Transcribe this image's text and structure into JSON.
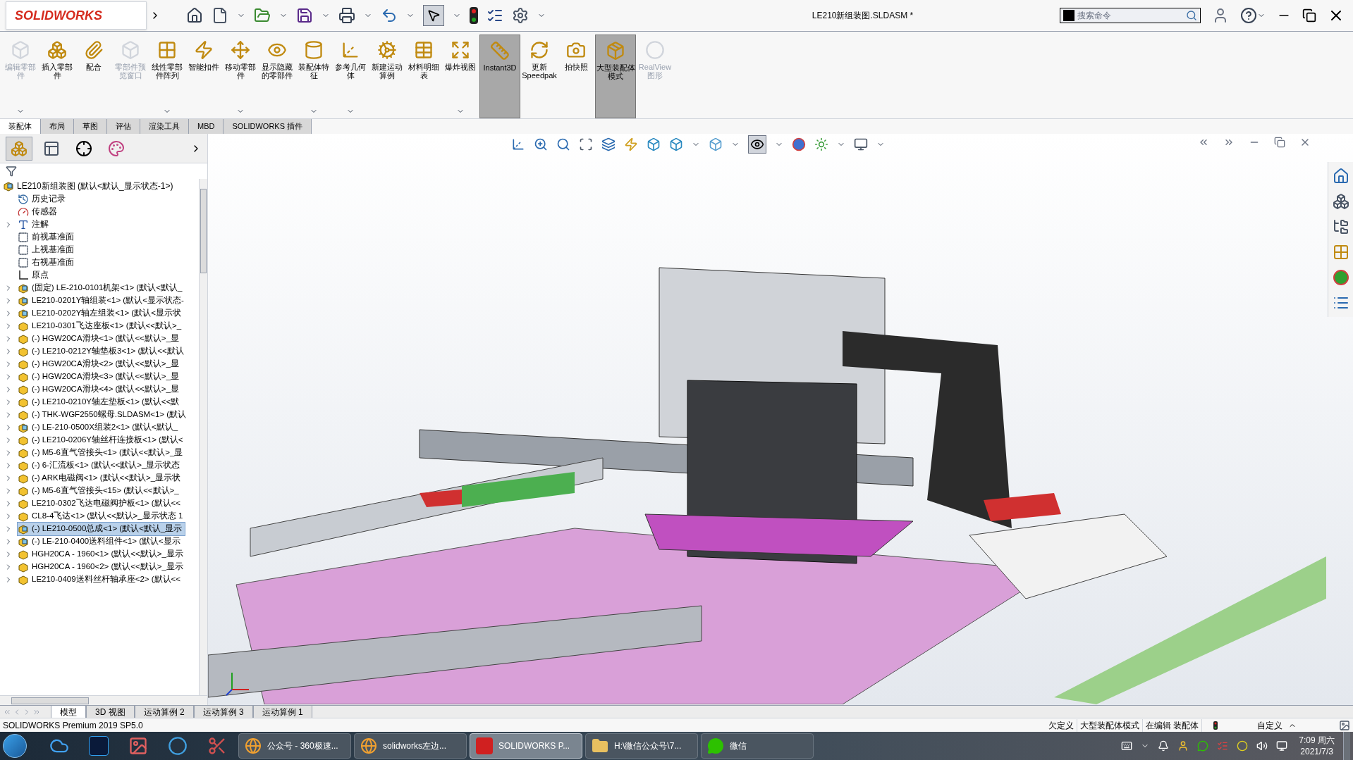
{
  "app": {
    "logo": "SOLIDWORKS",
    "title": "LE210新组装图.SLDASM *",
    "search": {
      "placeholder": "搜索命令"
    }
  },
  "ribbon": [
    {
      "label": "编辑零部件",
      "disabled": true,
      "selected": false,
      "dropdown": true
    },
    {
      "label": "插入零部件",
      "disabled": false,
      "selected": false,
      "dropdown": false
    },
    {
      "label": "配合",
      "disabled": false,
      "selected": false,
      "dropdown": false
    },
    {
      "label": "零部件预览窗口",
      "disabled": true,
      "selected": false,
      "dropdown": false
    },
    {
      "label": "线性零部件阵列",
      "disabled": false,
      "selected": false,
      "dropdown": true
    },
    {
      "label": "智能扣件",
      "disabled": false,
      "selected": false,
      "dropdown": false
    },
    {
      "label": "移动零部件",
      "disabled": false,
      "selected": false,
      "dropdown": true
    },
    {
      "label": "显示隐藏的零部件",
      "disabled": false,
      "selected": false,
      "dropdown": false
    },
    {
      "label": "装配体特征",
      "disabled": false,
      "selected": false,
      "dropdown": true
    },
    {
      "label": "参考几何体",
      "disabled": false,
      "selected": false,
      "dropdown": true
    },
    {
      "label": "新建运动算例",
      "disabled": false,
      "selected": false,
      "dropdown": false
    },
    {
      "label": "材料明细表",
      "disabled": false,
      "selected": false,
      "dropdown": false
    },
    {
      "label": "爆炸视图",
      "disabled": false,
      "selected": false,
      "dropdown": true
    },
    {
      "label": "Instant3D",
      "disabled": false,
      "selected": true,
      "dropdown": false
    },
    {
      "label": "更新 Speedpak",
      "disabled": false,
      "selected": false,
      "dropdown": false
    },
    {
      "label": "拍快照",
      "disabled": false,
      "selected": false,
      "dropdown": false
    },
    {
      "label": "大型装配体模式",
      "disabled": false,
      "selected": true,
      "dropdown": false
    },
    {
      "label": "RealView 图形",
      "disabled": true,
      "selected": false,
      "dropdown": false
    }
  ],
  "command_tabs": [
    {
      "label": "装配体",
      "selected": true
    },
    {
      "label": "布局",
      "selected": false
    },
    {
      "label": "草图",
      "selected": false
    },
    {
      "label": "评估",
      "selected": false
    },
    {
      "label": "渲染工具",
      "selected": false
    },
    {
      "label": "MBD",
      "selected": false
    },
    {
      "label": "SOLIDWORKS 插件",
      "selected": false
    }
  ],
  "tree": {
    "root": "LE210新组装图  (默认<默认_显示状态-1>)",
    "items": [
      {
        "kind": "history",
        "label": "历史记录",
        "expandable": false,
        "selected": false
      },
      {
        "kind": "sensor",
        "label": "传感器",
        "expandable": false,
        "selected": false
      },
      {
        "kind": "annotation",
        "label": "注解",
        "expandable": true,
        "selected": false
      },
      {
        "kind": "plane",
        "label": "前视基准面",
        "expandable": false,
        "selected": false
      },
      {
        "kind": "plane",
        "label": "上视基准面",
        "expandable": false,
        "selected": false
      },
      {
        "kind": "plane",
        "label": "右视基准面",
        "expandable": false,
        "selected": false
      },
      {
        "kind": "origin",
        "label": "原点",
        "expandable": false,
        "selected": false
      },
      {
        "kind": "assembly",
        "label": "(固定) LE-210-0101机架<1> (默认<默认_",
        "expandable": true,
        "selected": false
      },
      {
        "kind": "assembly",
        "label": "LE210-0201Y轴组装<1> (默认<显示状态-",
        "expandable": true,
        "selected": false
      },
      {
        "kind": "assembly",
        "label": "LE210-0202Y轴左组装<1> (默认<显示状",
        "expandable": true,
        "selected": false
      },
      {
        "kind": "part",
        "label": "LE210-0301飞达座板<1> (默认<<默认>_",
        "expandable": true,
        "selected": false
      },
      {
        "kind": "part",
        "label": "(-) HGW20CA滑块<1> (默认<<默认>_显",
        "expandable": true,
        "selected": false
      },
      {
        "kind": "part",
        "label": "(-) LE210-0212Y轴垫板3<1> (默认<<默认",
        "expandable": true,
        "selected": false
      },
      {
        "kind": "part",
        "label": "(-) HGW20CA滑块<2> (默认<<默认>_显",
        "expandable": true,
        "selected": false
      },
      {
        "kind": "part",
        "label": "(-) HGW20CA滑块<3> (默认<<默认>_显",
        "expandable": true,
        "selected": false
      },
      {
        "kind": "part",
        "label": "(-) HGW20CA滑块<4> (默认<<默认>_显",
        "expandable": true,
        "selected": false
      },
      {
        "kind": "part",
        "label": "(-) LE210-0210Y轴左垫板<1> (默认<<默",
        "expandable": true,
        "selected": false
      },
      {
        "kind": "part",
        "label": "(-) THK-WGF2550螺母.SLDASM<1> (默认",
        "expandable": true,
        "selected": false
      },
      {
        "kind": "assembly",
        "label": "(-) LE-210-0500X组装2<1> (默认<默认_",
        "expandable": true,
        "selected": false
      },
      {
        "kind": "part",
        "label": "(-) LE210-0206Y轴丝杆连接板<1> (默认<",
        "expandable": true,
        "selected": false
      },
      {
        "kind": "part",
        "label": "(-) M5-6直气管接头<1> (默认<<默认>_显",
        "expandable": true,
        "selected": false
      },
      {
        "kind": "part",
        "label": "(-) 6-汇流板<1> (默认<<默认>_显示状态",
        "expandable": true,
        "selected": false
      },
      {
        "kind": "part",
        "label": "(-) ARK电磁阀<1> (默认<<默认>_显示状",
        "expandable": true,
        "selected": false
      },
      {
        "kind": "part",
        "label": "(-) M5-6直气管接头<15> (默认<<默认>_",
        "expandable": true,
        "selected": false
      },
      {
        "kind": "part",
        "label": "LE210-0302飞达电磁阀护板<1> (默认<<",
        "expandable": true,
        "selected": false
      },
      {
        "kind": "part",
        "label": "CL8-4飞达<1> (默认<<默认>_显示状态 1",
        "expandable": true,
        "selected": false
      },
      {
        "kind": "assembly",
        "label": "(-) LE210-0500总成<1> (默认<默认_显示",
        "expandable": true,
        "selected": true
      },
      {
        "kind": "assembly",
        "label": "(-) LE-210-0400送料组件<1> (默认<显示",
        "expandable": true,
        "selected": false
      },
      {
        "kind": "part",
        "label": "HGH20CA - 1960<1> (默认<<默认>_显示",
        "expandable": true,
        "selected": false
      },
      {
        "kind": "part",
        "label": "HGH20CA - 1960<2> (默认<<默认>_显示",
        "expandable": true,
        "selected": false
      },
      {
        "kind": "part",
        "label": "LE210-0409送料丝杆轴承座<2> (默认<<",
        "expandable": true,
        "selected": false
      }
    ]
  },
  "bottom_tabs": [
    {
      "label": "模型",
      "selected": true
    },
    {
      "label": "3D 视图",
      "selected": false
    },
    {
      "label": "运动算例 2",
      "selected": false
    },
    {
      "label": "运动算例 3",
      "selected": false
    },
    {
      "label": "运动算例 1",
      "selected": false
    }
  ],
  "status": {
    "product": "SOLIDWORKS Premium 2019 SP5.0",
    "items": [
      "欠定义",
      "大型装配体模式",
      "在编辑 装配体"
    ],
    "units": "自定义"
  },
  "taskbar": {
    "windows": [
      {
        "kind": "browser",
        "label": "公众号 - 360极速...",
        "selected": false
      },
      {
        "kind": "browser",
        "label": "solidworks左边...",
        "selected": false
      },
      {
        "kind": "solidworks",
        "label": "SOLIDWORKS P...",
        "selected": true
      },
      {
        "kind": "folder",
        "label": "H:\\微信公众号\\7...",
        "selected": false
      },
      {
        "kind": "wechat",
        "label": "微信",
        "selected": false
      }
    ],
    "time": "7:09 周六",
    "date": "2021/7/3"
  }
}
